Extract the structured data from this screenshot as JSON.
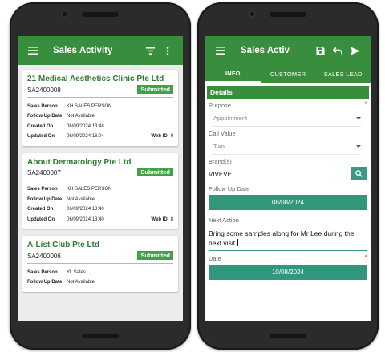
{
  "left_screen": {
    "title": "Sales Activity",
    "cards": [
      {
        "name": "21 Medical Aesthetics Clinic Pte Ltd",
        "code": "SA2400008",
        "status": "Submitted",
        "sales_person_label": "Sales Person",
        "sales_person": "KH SALES PERSON",
        "follow_up_label": "Follow Up Date",
        "follow_up": "Not Available",
        "created_label": "Created On",
        "created": "06/09/2024 13:48",
        "updated_label": "Updated On",
        "updated": "06/09/2024 16:04",
        "web_id_label": "Web ID",
        "web_id": "9"
      },
      {
        "name": "About Dermatology Pte Ltd",
        "code": "SA2400007",
        "status": "Submitted",
        "sales_person_label": "Sales Person",
        "sales_person": "KH SALES PERSON",
        "follow_up_label": "Follow Up Date",
        "follow_up": "Not Available",
        "created_label": "Created On",
        "created": "06/09/2024 13:40",
        "updated_label": "Updated On",
        "updated": "06/09/2024 13:40",
        "web_id_label": "Web ID",
        "web_id": "8"
      },
      {
        "name": "A-List Club Pte Ltd",
        "code": "SA2400006",
        "status": "Submitted",
        "sales_person_label": "Sales Person",
        "sales_person": "YL Sales",
        "follow_up_label": "Follow Up Date",
        "follow_up": "Not Available"
      }
    ]
  },
  "right_screen": {
    "title": "Sales Activ",
    "tabs": [
      "INFO",
      "CUSTOMER",
      "SALES LEAD"
    ],
    "section": "Details",
    "purpose_label": "Purpose",
    "purpose_value": "Appointment",
    "call_value_label": "Call Value",
    "call_value": "Two",
    "brand_label": "Brand(s)",
    "brand_value": "VIVEVE",
    "follow_up_label": "Follow Up Date",
    "follow_up_value": "08/08/2024",
    "next_action_label": "Next Action",
    "next_action_value": "Bring some samples along for Mr Lee during the next visit.",
    "date_label": "Date",
    "date_value": "10/08/2024",
    "required_mark": "*"
  },
  "colors": {
    "app_bar": "#388e3c",
    "accent_teal": "#32987c",
    "badge_green": "#43a047",
    "required_red": "#e53935"
  },
  "icons": [
    "menu-icon",
    "filter-icon",
    "more-vert-icon",
    "save-icon",
    "undo-icon",
    "send-icon",
    "search-icon",
    "dropdown-caret-icon"
  ]
}
